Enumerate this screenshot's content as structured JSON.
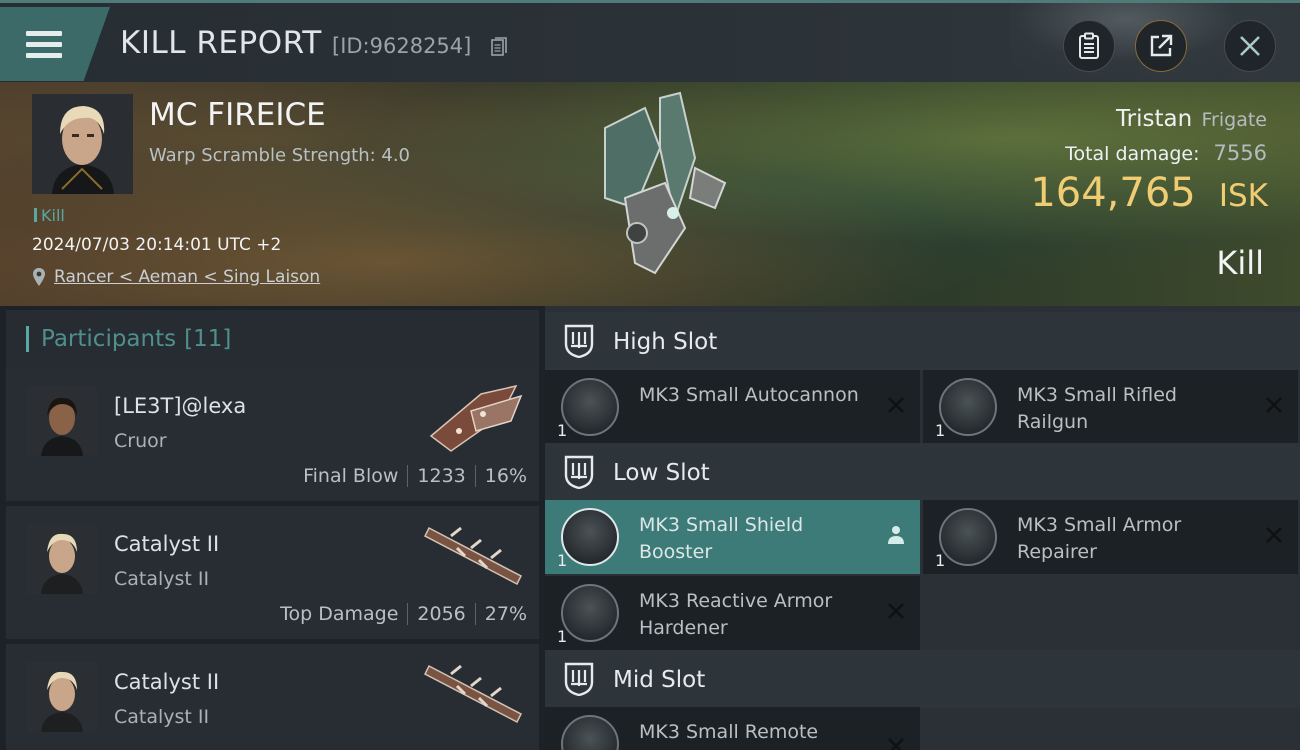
{
  "header": {
    "title": "KILL REPORT",
    "report_id": "[ID:9628254]",
    "buttons": [
      "clipboard-icon",
      "share-icon",
      "close-icon"
    ]
  },
  "victim": {
    "name": "MC FIREICE",
    "warp_scramble": "Warp Scramble Strength: 4.0",
    "kill_tag": "Kill",
    "timestamp": "2024/07/03 20:14:01 UTC +2",
    "location": "Rancer < Aeman < Sing Laison",
    "ship_name": "Tristan",
    "ship_class": "Frigate",
    "total_damage_label": "Total damage:",
    "total_damage": "7556",
    "isk_value": "164,765",
    "isk_unit": "ISK",
    "result": "Kill"
  },
  "participants": {
    "label": "Participants",
    "count": "[11]",
    "items": [
      {
        "name": "[LE3T]@lexa",
        "ship": "Cruor",
        "role": "Final Blow",
        "damage": "1233",
        "percent": "16%"
      },
      {
        "name": "Catalyst II",
        "ship": "Catalyst II",
        "role": "Top Damage",
        "damage": "2056",
        "percent": "27%"
      },
      {
        "name": "Catalyst II",
        "ship": "Catalyst II",
        "role": "",
        "damage": "",
        "percent": ""
      }
    ]
  },
  "slots": {
    "high": {
      "label": "High Slot",
      "modules": [
        {
          "name": "MK3 Small Autocannon",
          "qty": "1",
          "status": "destroyed"
        },
        {
          "name": "MK3 Small Rifled Railgun",
          "qty": "1",
          "status": "destroyed"
        }
      ]
    },
    "low": {
      "label": "Low Slot",
      "modules": [
        {
          "name": "MK3 Small Shield Booster",
          "qty": "1",
          "status": "dropped"
        },
        {
          "name": "MK3 Small Armor Repairer",
          "qty": "1",
          "status": "destroyed"
        },
        {
          "name": "MK3 Reactive Armor Hardener",
          "qty": "1",
          "status": "destroyed"
        }
      ]
    },
    "mid": {
      "label": "Mid Slot",
      "modules": [
        {
          "name": "MK3 Small Remote",
          "qty": "",
          "status": "destroyed"
        }
      ]
    }
  },
  "colors": {
    "accent_teal": "#3c7b78",
    "isk_gold": "#f0cd72",
    "participants_label": "#4f8f8d"
  }
}
